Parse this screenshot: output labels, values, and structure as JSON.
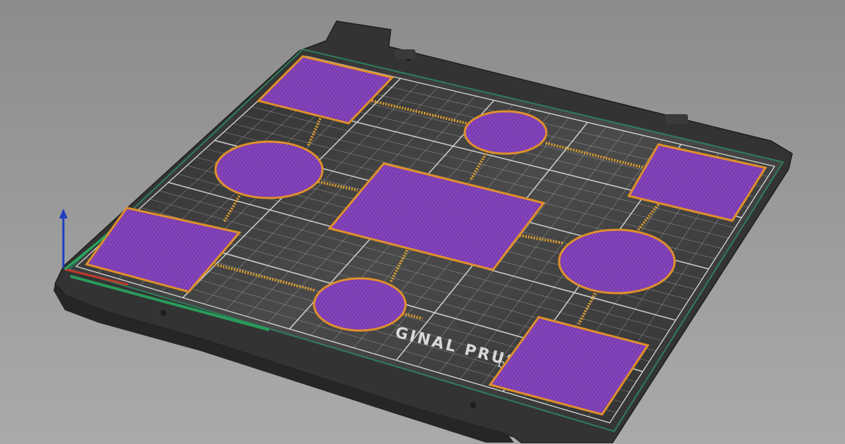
{
  "viewport": {
    "background_top": "#8c8c8c",
    "background_bottom": "#aaaaaa"
  },
  "bed": {
    "plate_color": "#333333",
    "sheet_color": "#2e2e2e",
    "grid_color": "#d8d8d8",
    "logo_text": "GINAL PRUS",
    "logo_text_2": "b"
  },
  "parts": {
    "fill_color": "#7a3bb0",
    "outline_color": "#e0902a",
    "connector_color": "#e0a030",
    "items": [
      {
        "shape": "square",
        "name": "part-square-1"
      },
      {
        "shape": "circle",
        "name": "part-circle-1"
      },
      {
        "shape": "circle",
        "name": "part-circle-2"
      },
      {
        "shape": "square",
        "name": "part-square-2"
      },
      {
        "shape": "rectangle",
        "name": "part-rect-center"
      },
      {
        "shape": "square",
        "name": "part-square-3"
      },
      {
        "shape": "circle",
        "name": "part-circle-3"
      },
      {
        "shape": "circle",
        "name": "part-circle-4"
      },
      {
        "shape": "square",
        "name": "part-square-4"
      }
    ]
  },
  "axes": {
    "x_color": "#c0392b",
    "y_color": "#27ae60",
    "z_color": "#1f3fbf"
  }
}
